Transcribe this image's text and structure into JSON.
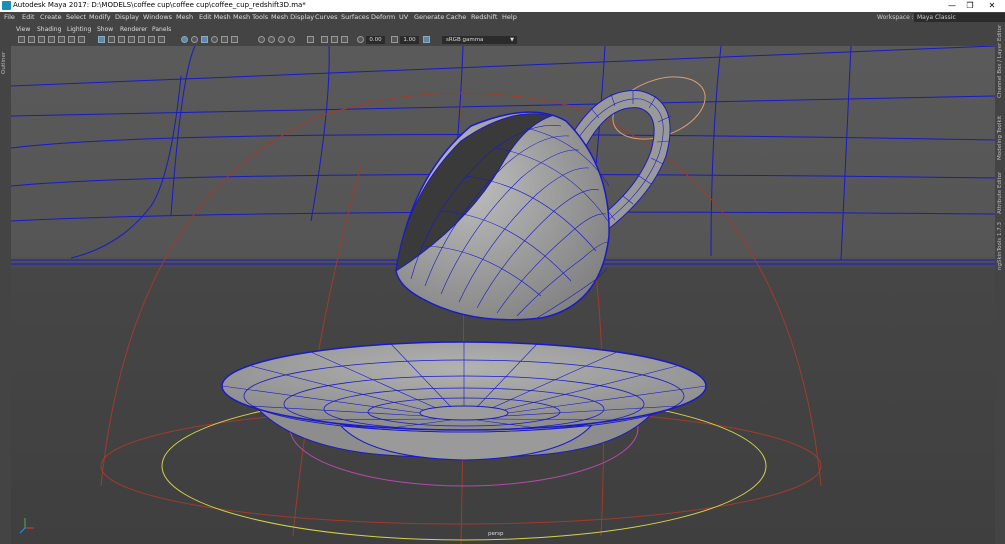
{
  "window": {
    "title": "Autodesk Maya 2017: D:\\MODELS\\coffee cup\\coffee cup\\coffee_cup_redshift3D.ma*",
    "minimize": "—",
    "maximize": "❐",
    "close": "✕"
  },
  "menubar": {
    "items": [
      "File",
      "Edit",
      "Create",
      "Select",
      "Modify",
      "Display",
      "Windows",
      "Mesh",
      "Edit Mesh",
      "Mesh Tools",
      "Mesh Display",
      "Curves",
      "Surfaces",
      "Deform",
      "UV",
      "Generate",
      "Cache",
      "Redshift",
      "Help"
    ],
    "workspace_label": "Workspace :",
    "workspace_value": "Maya Classic"
  },
  "left_edge": {
    "outliner_label": "Outliner"
  },
  "right_edge": {
    "tabs": [
      "Channel Box / Layer Editor",
      "Modeling Toolkit",
      "Attribute Editor",
      "ngSkinTools 1.7.3"
    ]
  },
  "panel_menu": {
    "items": [
      "View",
      "Shading",
      "Lighting",
      "Show",
      "Renderer",
      "Panels"
    ]
  },
  "panel_toolbar": {
    "exposure_value": "0.00",
    "gamma_value": "1.00",
    "color_space": "sRGB gamma",
    "icons": [
      "camera-select-icon",
      "camera-attributes-icon",
      "bookmarks-icon",
      "image-plane-icon",
      "2d-pan-zoom-icon",
      "grease-pencil-icon",
      "grid-icon",
      "film-gate-icon",
      "resolution-gate-icon",
      "gate-mask-icon",
      "field-chart-icon",
      "safe-action-icon",
      "safe-title-icon",
      "wireframe-icon",
      "smooth-shade-icon",
      "default-material-icon",
      "wireframe-on-shaded-icon",
      "textured-icon",
      "use-all-lights-icon",
      "shadows-icon",
      "screen-space-ao-icon",
      "motion-blur-icon",
      "anti-aliasing-icon",
      "depth-of-field-icon",
      "isolate-select-icon",
      "xray-icon",
      "xray-active-icon",
      "xray-joints-icon",
      "exposure-icon",
      "gamma-icon",
      "color-management-icon"
    ]
  },
  "viewport": {
    "camera": "persp",
    "colors": {
      "background_top": "#5a5a5a",
      "background_bottom": "#3f3f3f",
      "wire": "#1a1ac8",
      "mesh": "#9a9a9a",
      "curve_red": "#a13b2a",
      "curve_yellow": "#d6d24a",
      "curve_magenta": "#b44aa8",
      "curve_orange": "#d8a070"
    }
  }
}
